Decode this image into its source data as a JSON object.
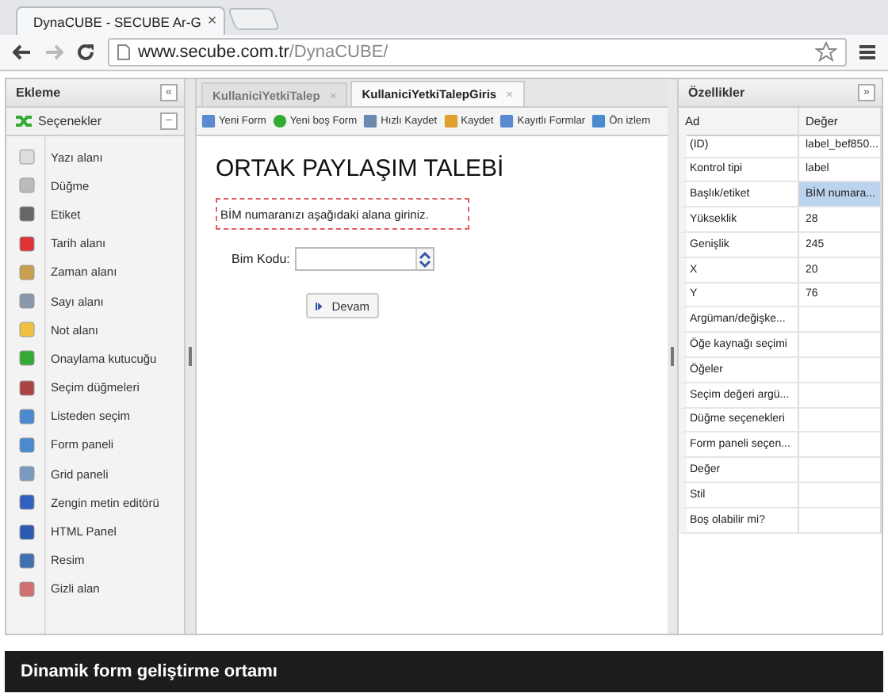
{
  "browser": {
    "tab_title": "DynaCUBE - SECUBE Ar-G",
    "tab_close": "×",
    "url_host": "www.secube.com.tr",
    "url_path": "/DynaCUBE/"
  },
  "left_panel": {
    "title": "Ekleme",
    "collapse": "«",
    "section": "Seçenekler",
    "section_toggle": "−",
    "items": [
      {
        "label": "Yazı alanı"
      },
      {
        "label": "Düğme"
      },
      {
        "label": "Etiket"
      },
      {
        "label": "Tarih alanı"
      },
      {
        "label": "Zaman alanı"
      },
      {
        "label": "Sayı alanı"
      },
      {
        "label": "Not alanı"
      },
      {
        "label": "Onaylama kutucuğu"
      },
      {
        "label": "Seçim düğmeleri"
      },
      {
        "label": "Listeden seçim"
      },
      {
        "label": "Form paneli"
      },
      {
        "label": "Grid paneli"
      },
      {
        "label": "Zengin metin editörü"
      },
      {
        "label": "HTML Panel"
      },
      {
        "label": "Resim"
      },
      {
        "label": "Gizli alan"
      }
    ]
  },
  "tabs": [
    {
      "label": "KullaniciYetkiTalep",
      "close": "×",
      "selected": false
    },
    {
      "label": "KullaniciYetkiTalepGiris",
      "close": "×",
      "selected": true
    }
  ],
  "toolbar": [
    {
      "label": "Yeni Form"
    },
    {
      "label": "Yeni boş Form"
    },
    {
      "label": "Hızlı Kaydet"
    },
    {
      "label": "Kaydet"
    },
    {
      "label": "Kayıtlı Formlar"
    },
    {
      "label": "Ön izlem"
    }
  ],
  "form": {
    "title": "ORTAK PAYLAŞIM TALEBİ",
    "info": "BİM numaranızı aşağıdaki alana giriniz.",
    "field_label": "Bim Kodu:",
    "button": "Devam"
  },
  "properties": {
    "title": "Özellikler",
    "expand": "»",
    "columns": [
      "Ad",
      "Değer"
    ],
    "rows": [
      {
        "name": "(ID)",
        "value": "label_bef850...",
        "selected": false
      },
      {
        "name": "Kontrol tipi",
        "value": "label",
        "selected": false
      },
      {
        "name": "Başlık/etiket",
        "value": "BİM numara...",
        "selected": true
      },
      {
        "name": "Yükseklik",
        "value": "28",
        "selected": false
      },
      {
        "name": "Genişlik",
        "value": "245",
        "selected": false
      },
      {
        "name": "X",
        "value": "20",
        "selected": false
      },
      {
        "name": "Y",
        "value": "76",
        "selected": false
      },
      {
        "name": "Argüman/değişke...",
        "selected": false
      },
      {
        "name": "Öğe kaynağı seçimi",
        "selected": false
      },
      {
        "name": "Öğeler",
        "selected": false
      },
      {
        "name": "Seçim değeri argü...",
        "selected": false
      },
      {
        "name": "Düğme seçenekleri",
        "selected": false
      },
      {
        "name": "Form paneli seçen...",
        "selected": false
      },
      {
        "name": "Değer",
        "selected": false
      },
      {
        "name": "Stil",
        "selected": false
      },
      {
        "name": "Boş olabilir mi?",
        "selected": false
      }
    ]
  },
  "caption": "Dinamik form geliştirme ortamı"
}
